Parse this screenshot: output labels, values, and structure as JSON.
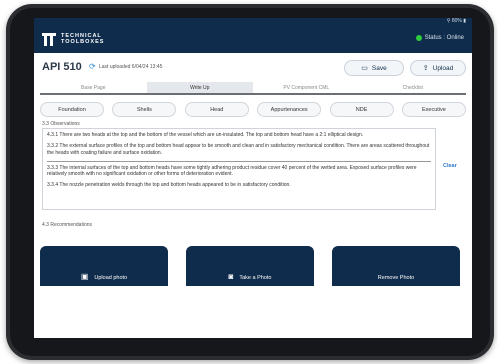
{
  "status_bar": {
    "battery": "⚲ 80% ▮"
  },
  "header": {
    "logo_line1": "TECHNICAL",
    "logo_line2": "TOOLBOXES",
    "status_text": "Status : Online"
  },
  "title_row": {
    "title": "API 510",
    "last_uploaded": "Last uploaded 6/04/24 13:45",
    "save_label": "Save",
    "upload_label": "Upload"
  },
  "tabs": [
    {
      "label": "Base Page"
    },
    {
      "label": "Write Up"
    },
    {
      "label": "PV Component CML"
    },
    {
      "label": "Checklist"
    }
  ],
  "chips": [
    {
      "label": "Foundation"
    },
    {
      "label": "Shells"
    },
    {
      "label": "Head"
    },
    {
      "label": "Appurtenances"
    },
    {
      "label": "NDE"
    },
    {
      "label": "Executive"
    }
  ],
  "observations": {
    "section_title": "3.3 Observations",
    "clear_label": "Clear",
    "lines": [
      "4.3.1 There are two heads at the top and the bottom of the vessel which are un-insulated. The top and bottom head have a 2:1 elliptical design.",
      "3.3.2 The external surface profiles of the top and bottom head appear to be smooth and clean and in satisfactory mechanical condition. There are areas scattered throughout the heads with coating failure and surface oxidation.",
      "3.3.3 The internal surfaces of the top and bottom heads have some tightly adhering product residue cover 40 percent of the wetted area. Exposed surface profiles were relatively smooth with no significant oxidation or other forms of deterioration evident.",
      "3.3.4 The nozzle penetration welds through the top and bottom heads appeared to be in satisfactory condition."
    ]
  },
  "recommendations": {
    "section_title": "4.3 Recommendations",
    "upload_photo": "Upload photo",
    "take_photo": "Take a Photo",
    "remove_photo": "Remove Photo"
  },
  "colors": {
    "navy": "#0f2c4c",
    "online": "#2ecc40",
    "link": "#2f78c4"
  }
}
